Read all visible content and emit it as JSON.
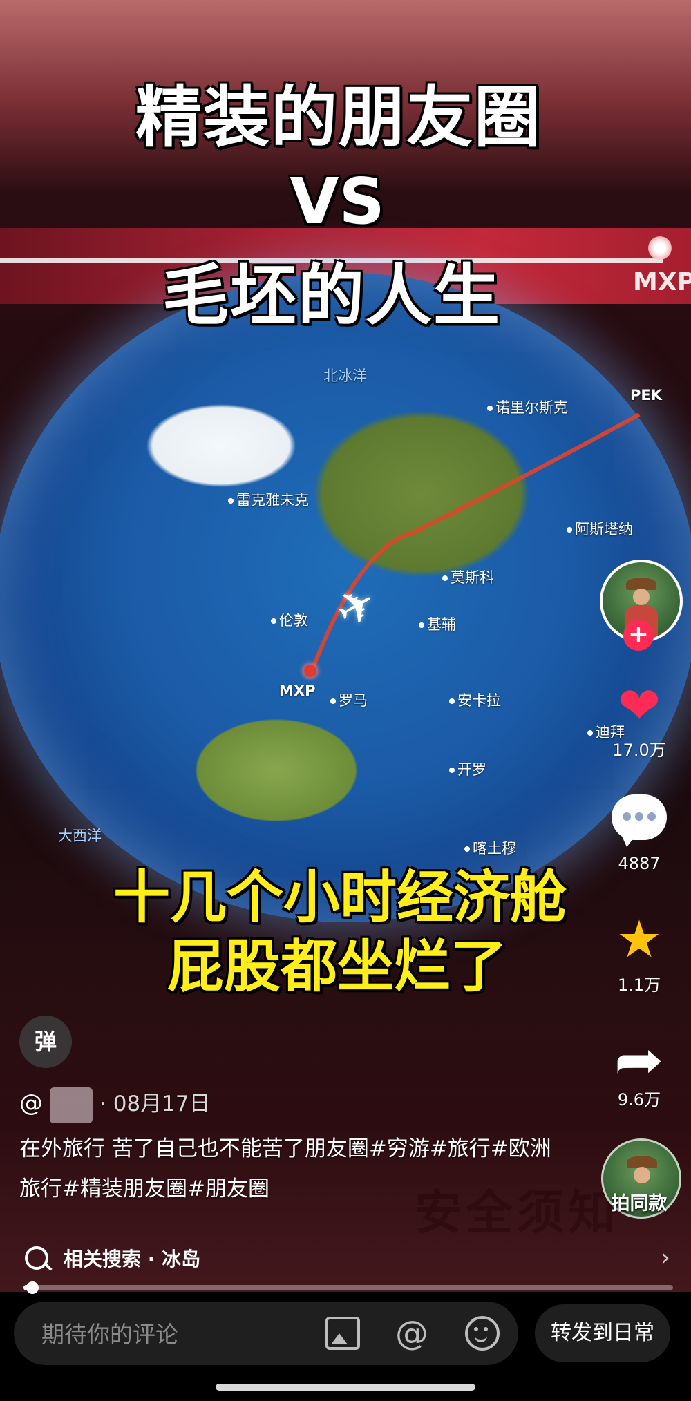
{
  "video": {
    "title_lines": [
      "精装的朋友圈",
      "VS",
      "毛坯的人生"
    ],
    "caption_lines": [
      "十几个小时经济舱",
      "屁股都坐烂了"
    ],
    "route_code_top": "MXP",
    "map_labels": {
      "arctic_ocean": "北冰洋",
      "norilsk": "诺里尔斯克",
      "pek": "PEK",
      "reykjavik": "雷克雅未克",
      "astana": "阿斯塔纳",
      "moscow": "莫斯科",
      "london": "伦敦",
      "kyiv": "基辅",
      "mxp": "MXP",
      "rome": "罗马",
      "ankara": "安卡拉",
      "dubai": "迪拜",
      "cairo": "开罗",
      "atlantic": "大西洋",
      "khartoum": "喀土穆"
    },
    "sign_text": "安全须知",
    "colors": {
      "caption": "#ffee1a",
      "like": "#fe2c55",
      "star": "#fdc40b"
    }
  },
  "actions": {
    "like_count": "17.0万",
    "comment_count": "4887",
    "favorite_count": "1.1万",
    "share_count": "9.6万",
    "follow_symbol": "+",
    "same_style_label": "拍同款",
    "icons": [
      "heart-icon",
      "comment-icon",
      "star-icon",
      "share-icon"
    ]
  },
  "post": {
    "danmaku_label": "弹",
    "at_symbol": "@",
    "date": "· 08月17日",
    "description": "在外旅行 苦了自己也不能苦了朋友圈#穷游#旅行#欧洲旅行#精装朋友圈#朋友圈",
    "related_search": "相关搜索 · 冰岛",
    "progress": 0.01
  },
  "bottom_bar": {
    "comment_placeholder": "期待你的评论",
    "at_label": "@",
    "forward_label": "转发到日常"
  }
}
